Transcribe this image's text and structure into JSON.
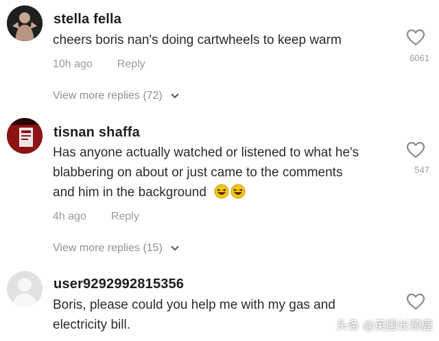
{
  "comments": [
    {
      "username": "stella fella",
      "text_lines": [
        "cheers boris nan's doing cartwheels to keep warm"
      ],
      "time": "10h ago",
      "reply_label": "Reply",
      "like_count": "6061",
      "view_more": "View more replies (72)"
    },
    {
      "username": "tisnan shaffa",
      "text_lines": [
        "Has anyone actually watched or listened to what he's",
        "blabbering on about or just came to the comments",
        "and him in the background"
      ],
      "time": "4h ago",
      "reply_label": "Reply",
      "like_count": "547",
      "view_more": "View more replies (15)"
    },
    {
      "username": "user9292992815356",
      "text_lines": [
        "Boris, please could you help me with my gas and",
        "electricity bill."
      ]
    }
  ],
  "watermark": "头条 @英国长颈鹿",
  "icons": {
    "like": "heart-outline-icon",
    "chevron": "chevron-down-icon",
    "emoji": "laughing-emoji-icon"
  },
  "colors": {
    "username": "#1d1d1d",
    "meta": "#9a9a9a",
    "emoji": "#f5c518"
  }
}
